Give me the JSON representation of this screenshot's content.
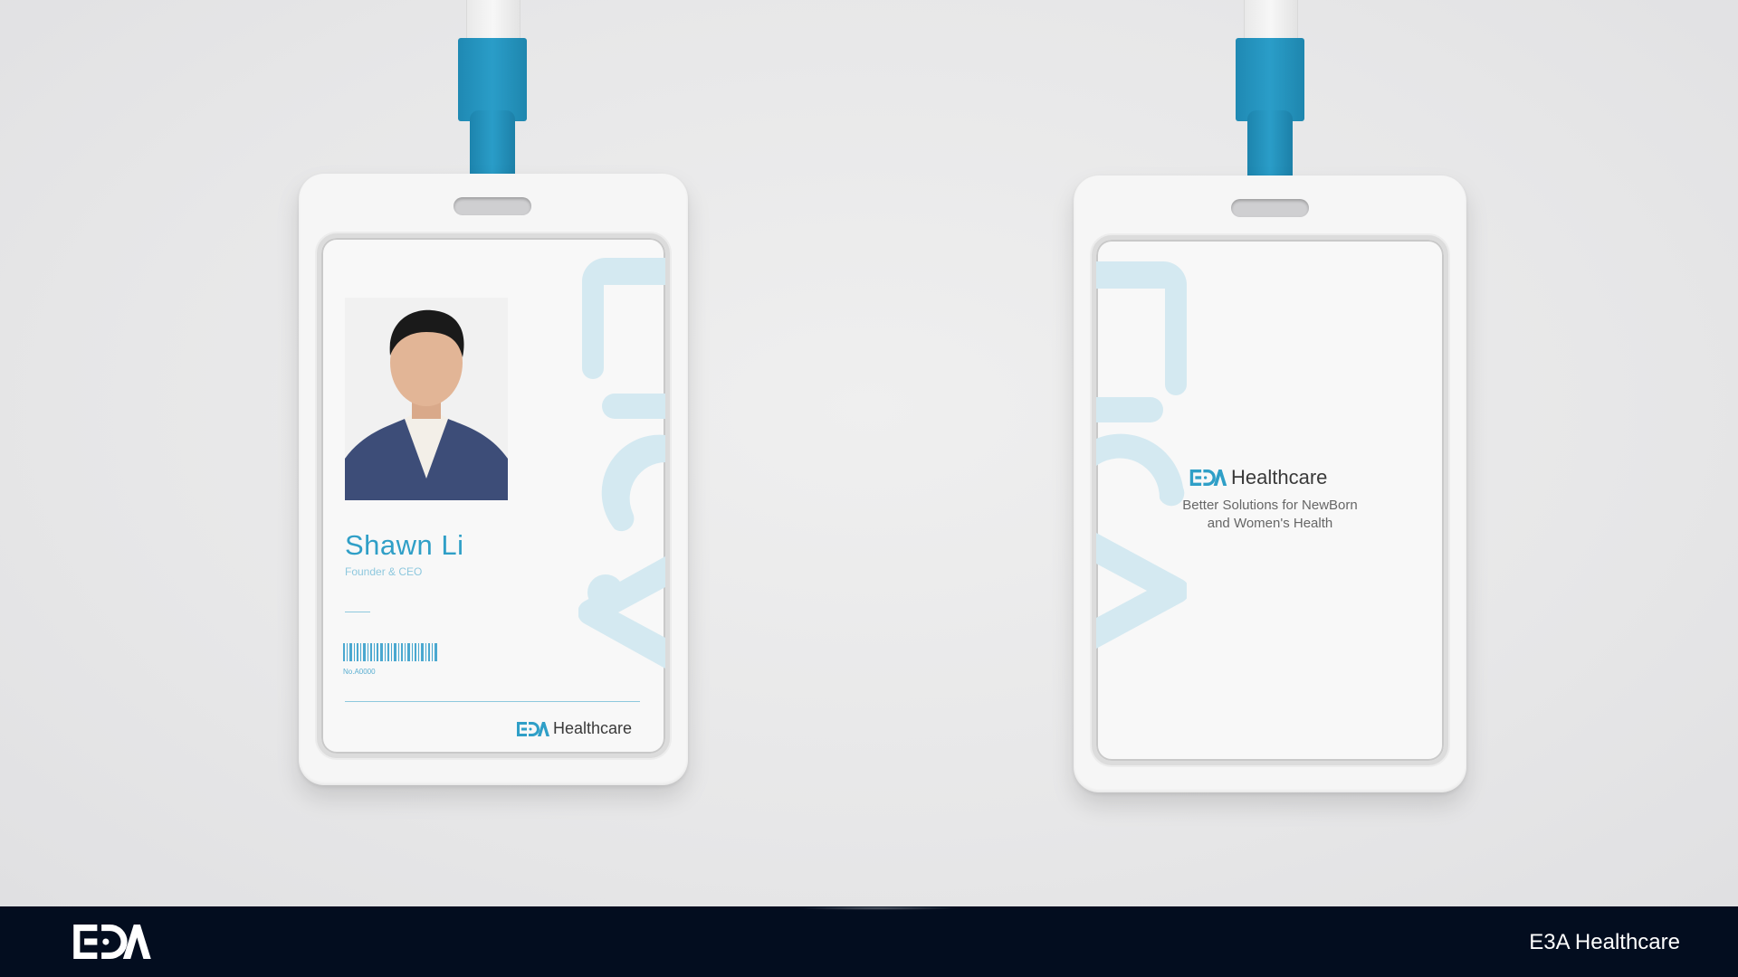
{
  "front_card": {
    "name": "Shawn Li",
    "title": "Founder & CEO",
    "badge_number": "No.A0000",
    "brand_suffix": "Healthcare"
  },
  "back_card": {
    "brand_suffix": "Healthcare",
    "tagline_line1": "Better Solutions for NewBorn",
    "tagline_line2": "and Women's Health"
  },
  "footer": {
    "company_name": "E3A Healthcare"
  },
  "icons": {
    "brand_logo": "e3a-logo-icon",
    "photo": "portrait-photo",
    "barcode": "barcode-icon"
  },
  "colors": {
    "accent": "#2f9fc7",
    "lanyard_clip": "#2a9dc8",
    "footer_bg": "#030d1f",
    "watermark": "#d4e9f1"
  }
}
